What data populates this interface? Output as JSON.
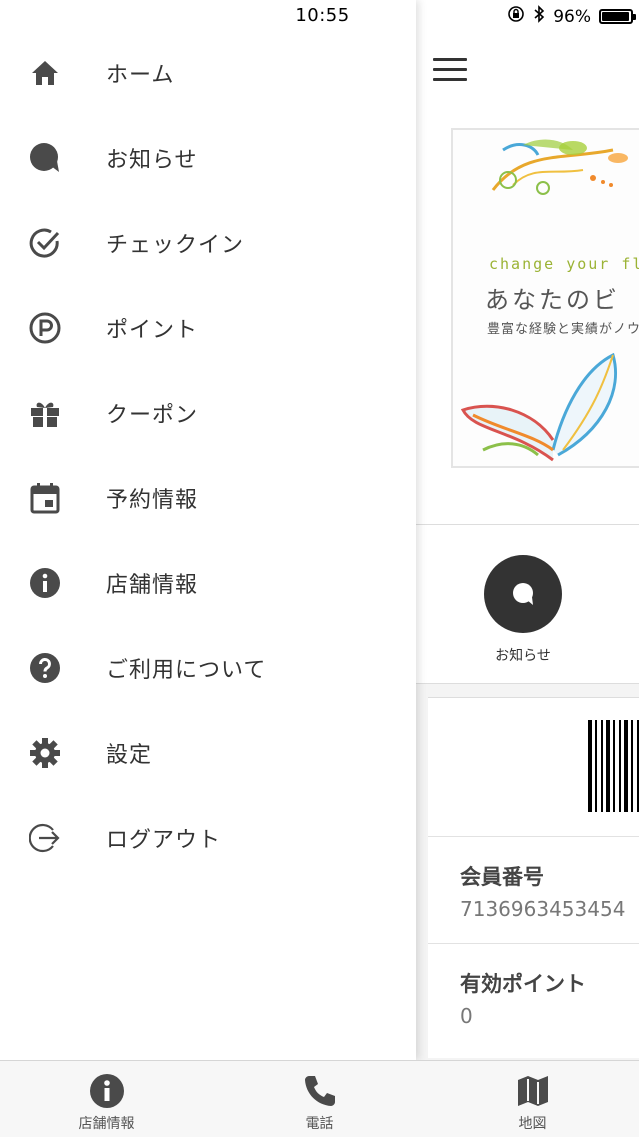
{
  "status_bar": {
    "time": "10:55",
    "battery": "96%",
    "battery_level": 0.96
  },
  "drawer": {
    "items": [
      {
        "label": "ホーム",
        "icon": "home-icon"
      },
      {
        "label": "お知らせ",
        "icon": "chat-bubble-icon"
      },
      {
        "label": "チェックイン",
        "icon": "check-circle-icon"
      },
      {
        "label": "ポイント",
        "icon": "point-p-icon"
      },
      {
        "label": "クーポン",
        "icon": "gift-icon"
      },
      {
        "label": "予約情報",
        "icon": "calendar-icon"
      },
      {
        "label": "店舗情報",
        "icon": "info-icon"
      },
      {
        "label": "ご利用について",
        "icon": "help-icon"
      },
      {
        "label": "設定",
        "icon": "gear-icon"
      },
      {
        "label": "ログアウト",
        "icon": "logout-icon"
      }
    ]
  },
  "main": {
    "banner": {
      "tagline": "change your fla",
      "headline": "あなたのビ",
      "subline": "豊富な経験と実績がノウ"
    },
    "quick_action": {
      "label": "お知らせ",
      "icon": "chat-bubble-icon"
    },
    "member": {
      "number_label": "会員番号",
      "number_value": "7136963453454",
      "points_label": "有効ポイント",
      "points_value": "0"
    }
  },
  "tab_bar": {
    "tabs": [
      {
        "label": "店舗情報",
        "icon": "info-icon"
      },
      {
        "label": "電話",
        "icon": "phone-icon"
      },
      {
        "label": "地図",
        "icon": "map-icon"
      }
    ]
  },
  "colors": {
    "icon": "#4a4a4a",
    "accent_green": "#9bb335",
    "quick_circle": "#333333"
  }
}
